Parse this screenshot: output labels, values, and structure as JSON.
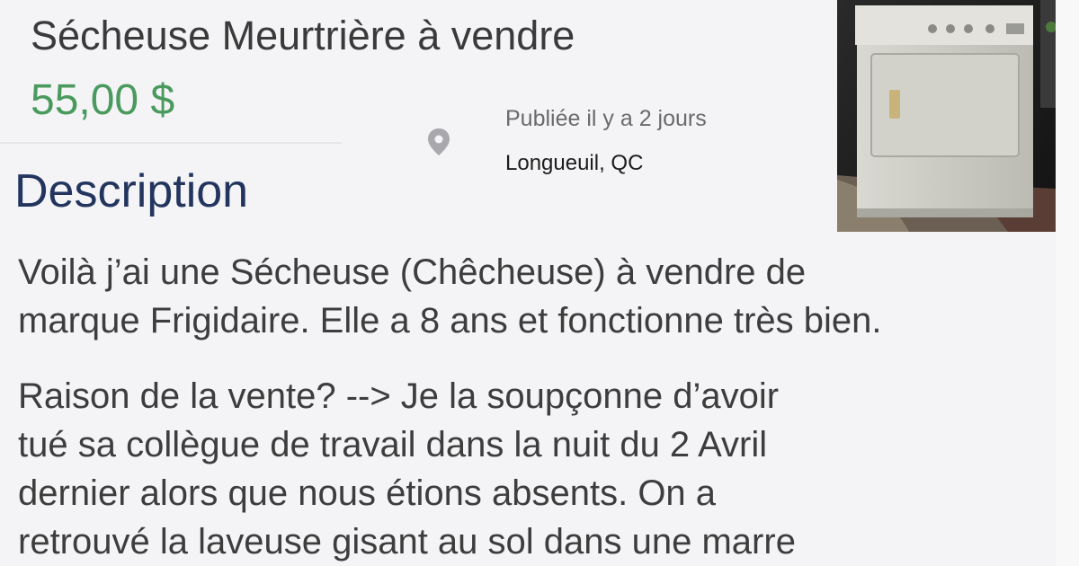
{
  "listing": {
    "title": "Sécheuse Meurtrière à vendre",
    "price": "55,00 $",
    "posted": "Publiée il y a 2 jours",
    "location": "Longueuil, QC",
    "location_icon": "map-pin-icon",
    "photo_subject": "dryer-photo"
  },
  "description": {
    "heading": "Description",
    "paragraph1": [
      "Voilà j’ai une Sécheuse (Chêcheuse) à vendre de",
      "marque Frigidaire. Elle a 8 ans et fonctionne très bien."
    ],
    "paragraph2": [
      "Raison de la vente? --> Je la soupçonne d’avoir",
      "tué sa collègue de travail dans la nuit du 2 Avril",
      "dernier alors que nous étions absents. On a",
      "retrouvé la laveuse gisant au sol dans une marre"
    ]
  },
  "colors": {
    "price": "#4a9a5e",
    "heading": "#23355f",
    "text": "#3d3d3d"
  }
}
